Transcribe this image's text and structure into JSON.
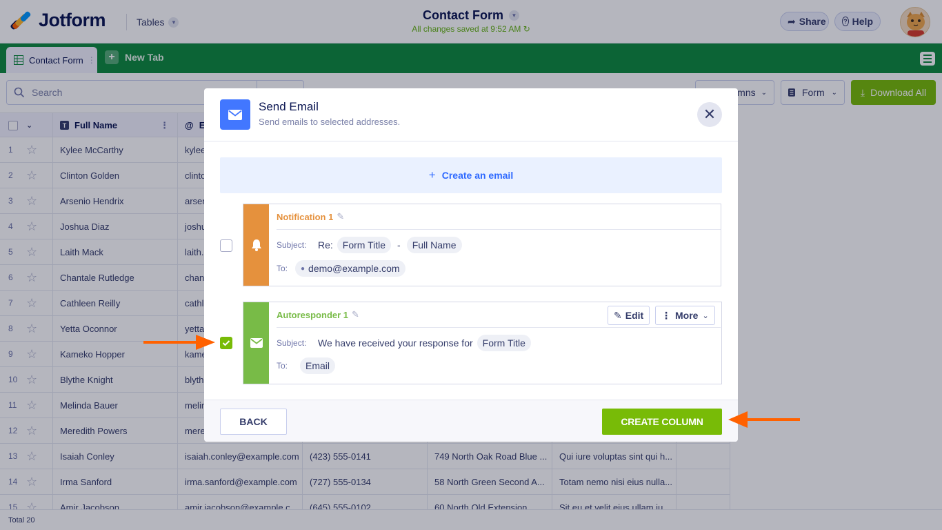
{
  "header": {
    "logo_text": "Jotform",
    "tables_label": "Tables",
    "form_title": "Contact Form",
    "saved_status": "All changes saved at 9:52 AM",
    "share_label": "Share",
    "help_label": "Help"
  },
  "tabs": {
    "active_label": "Contact Form",
    "new_tab_label": "New Tab"
  },
  "toolbar": {
    "search_placeholder": "Search",
    "columns_label": "umns",
    "form_label": "Form",
    "download_label": "Download All"
  },
  "table": {
    "columns": [
      "Full Name",
      "E"
    ],
    "rows": [
      {
        "n": "1",
        "name": "Kylee McCarthy",
        "email": "kylee",
        "phone": "",
        "address": "",
        "msg": ""
      },
      {
        "n": "2",
        "name": "Clinton Golden",
        "email": "clinto",
        "phone": "",
        "address": "",
        "msg": ""
      },
      {
        "n": "3",
        "name": "Arsenio Hendrix",
        "email": "arsen",
        "phone": "",
        "address": "",
        "msg": ""
      },
      {
        "n": "4",
        "name": "Joshua Diaz",
        "email": "joshu",
        "phone": "",
        "address": "",
        "msg": ""
      },
      {
        "n": "5",
        "name": "Laith Mack",
        "email": "laith.",
        "phone": "",
        "address": "",
        "msg": ""
      },
      {
        "n": "6",
        "name": "Chantale Rutledge",
        "email": "chant",
        "phone": "",
        "address": "",
        "msg": ""
      },
      {
        "n": "7",
        "name": "Cathleen Reilly",
        "email": "cathle",
        "phone": "",
        "address": "",
        "msg": ""
      },
      {
        "n": "8",
        "name": "Yetta Oconnor",
        "email": "yetta",
        "phone": "",
        "address": "",
        "msg": ""
      },
      {
        "n": "9",
        "name": "Kameko Hopper",
        "email": "kame",
        "phone": "",
        "address": "",
        "msg": ""
      },
      {
        "n": "10",
        "name": "Blythe Knight",
        "email": "blyth",
        "phone": "",
        "address": "",
        "msg": ""
      },
      {
        "n": "11",
        "name": "Melinda Bauer",
        "email": "melin",
        "phone": "",
        "address": "",
        "msg": ""
      },
      {
        "n": "12",
        "name": "Meredith Powers",
        "email": "mere",
        "phone": "",
        "address": "",
        "msg": ""
      },
      {
        "n": "13",
        "name": "Isaiah Conley",
        "email": "isaiah.conley@example.com",
        "phone": "(423) 555-0141",
        "address": "749 North Oak Road Blue ...",
        "msg": "Qui iure voluptas sint qui h..."
      },
      {
        "n": "14",
        "name": "Irma Sanford",
        "email": "irma.sanford@example.com",
        "phone": "(727) 555-0134",
        "address": "58 North Green Second A...",
        "msg": "Totam nemo nisi eius nulla..."
      },
      {
        "n": "15",
        "name": "Amir Jacobson",
        "email": "amir.jacobson@example.c...",
        "phone": "(645) 555-0102",
        "address": "60 North Old Extension",
        "msg": "Sit eu et velit eius ullam iu..."
      }
    ],
    "total_label": "Total 20"
  },
  "modal": {
    "title": "Send Email",
    "subtitle": "Send emails to selected addresses.",
    "create_email_label": "Create an email",
    "notification": {
      "name": "Notification 1",
      "subject_label": "Subject:",
      "subject_prefix": "Re:",
      "subject_tag1": "Form Title",
      "subject_sep": "-",
      "subject_tag2": "Full Name",
      "to_label": "To:",
      "to_value": "demo@example.com"
    },
    "autoresponder": {
      "name": "Autoresponder 1",
      "edit_label": "Edit",
      "more_label": "More",
      "subject_label": "Subject:",
      "subject_text": "We have received your response for",
      "subject_tag": "Form Title",
      "to_label": "To:",
      "to_value": "Email"
    },
    "back_label": "BACK",
    "create_column_label": "CREATE COLUMN"
  },
  "colors": {
    "brand_green": "#0e8a3d",
    "action_green": "#78bb07",
    "notification_orange": "#e5913d",
    "autoresponder_green": "#78bb47",
    "modal_blue": "#4277ff",
    "arrow_orange": "#ff6100"
  }
}
